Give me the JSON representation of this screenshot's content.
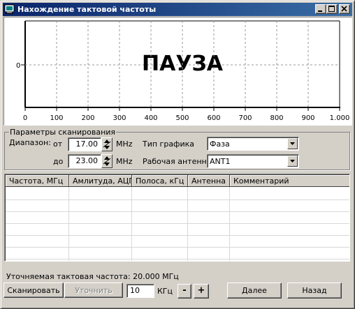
{
  "window": {
    "title": "Нахождение тактовой частоты"
  },
  "plot": {
    "overlay_text": "ПАУЗА",
    "y_tick": "0",
    "x_ticks": [
      "0",
      "100",
      "200",
      "300",
      "400",
      "500",
      "600",
      "700",
      "800",
      "900",
      "1.000"
    ]
  },
  "scan_params": {
    "group_title": "Параметры сканирования",
    "range_label": "Диапазон:",
    "from_label": "от",
    "to_label": "до",
    "from_value": "17.00",
    "to_value": "23.00",
    "unit_mhz": "MHz",
    "graph_type_label": "Тип графика",
    "graph_type_value": "Фаза",
    "antenna_label": "Рабочая антенна",
    "antenna_value": "ANT1"
  },
  "table": {
    "columns": [
      "Частота, МГц",
      "Амлитуда, АЦП",
      "Полоса, кГц",
      "Антенна",
      "Комментарий"
    ],
    "rows": []
  },
  "footer": {
    "refined_freq": "Уточняемая тактовая частота: 20.000 МГц",
    "scan_button": "Сканировать",
    "refine_button": "Уточнить",
    "step_value": "10",
    "step_unit": "КГц",
    "minus_button": "-",
    "plus_button": "+",
    "next_button": "Далее",
    "back_button": "Назад"
  },
  "colors": {
    "titlebar_start": "#0a246a",
    "titlebar_end": "#3a6ea5",
    "face": "#d4d0c8"
  }
}
